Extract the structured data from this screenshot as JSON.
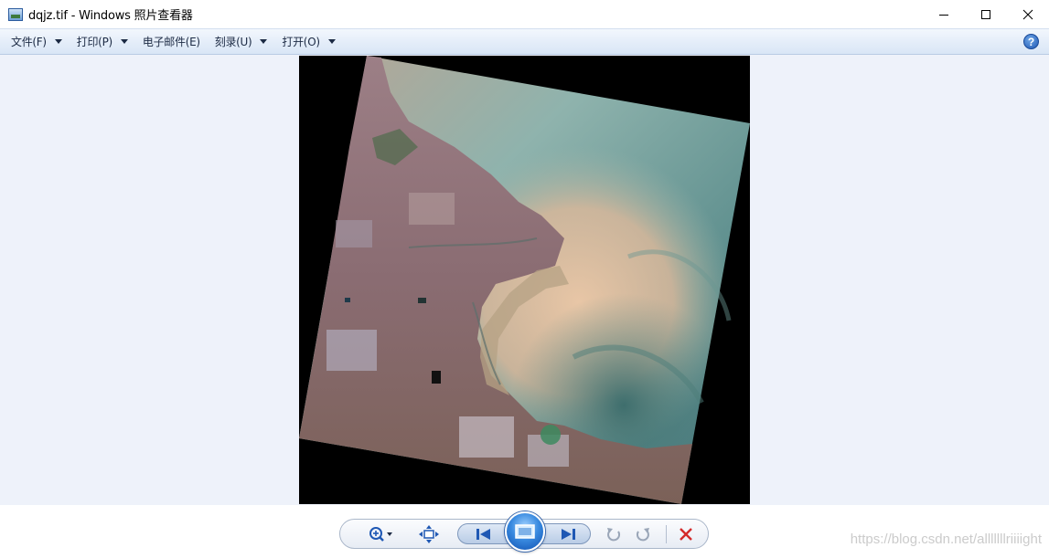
{
  "window": {
    "title": "dqjz.tif - Windows 照片查看器",
    "app_icon": "photo-viewer-icon",
    "controls": [
      "minimize-icon",
      "maximize-icon",
      "close-icon"
    ]
  },
  "menu": {
    "items": [
      {
        "label": "文件(F)",
        "has_dropdown": true
      },
      {
        "label": "打印(P)",
        "has_dropdown": true
      },
      {
        "label": "电子邮件(E)",
        "has_dropdown": false
      },
      {
        "label": "刻录(U)",
        "has_dropdown": true
      },
      {
        "label": "打开(O)",
        "has_dropdown": true
      }
    ],
    "help_label": "?"
  },
  "photo": {
    "subject": "satellite-image-coastline",
    "colors": {
      "viewer_bg": "#eef2fa",
      "frame_bg": "#000000"
    }
  },
  "toolbar": {
    "buttons": [
      "zoom-icon",
      "actual-size-icon",
      "previous-icon",
      "slideshow-icon",
      "next-icon",
      "rotate-left-icon",
      "rotate-right-icon",
      "delete-icon"
    ],
    "colors": {
      "accent": "#1f58b4",
      "delete": "#d42a2a"
    }
  },
  "watermark": {
    "text": "https://blog.csdn.net/alllllllriiiight"
  }
}
